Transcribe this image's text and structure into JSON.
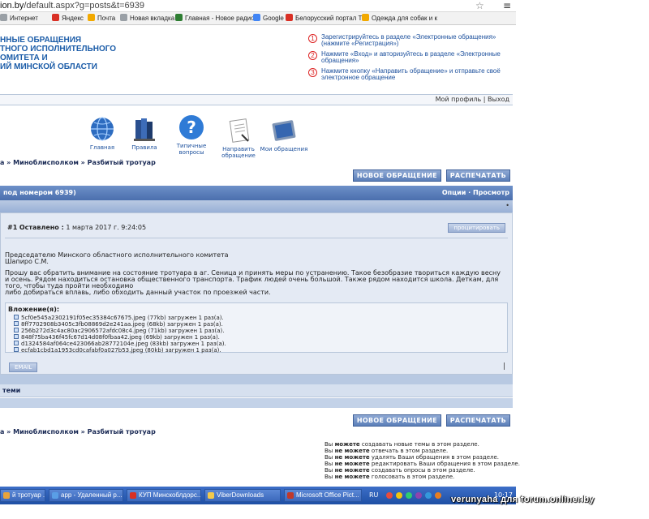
{
  "browser": {
    "url_host": "ion.by",
    "url_path": "/default.aspx?g=posts&t=6939",
    "star_icon": "star-icon",
    "menu_icon": "menu-icon"
  },
  "bookmarks": [
    {
      "label": "Интернет",
      "color": "#9aa0a6"
    },
    {
      "label": "Яндекс",
      "color": "#d93025"
    },
    {
      "label": "Почта",
      "color": "#f2a900"
    },
    {
      "label": "Новая вкладка",
      "color": "#9aa0a6"
    },
    {
      "label": "Главная - Новое радио",
      "color": "#2e7d32"
    },
    {
      "label": "Google",
      "color": "#4285f4"
    },
    {
      "label": "Белорусский портал Ti",
      "color": "#d93025"
    },
    {
      "label": "Одежда для собак и к",
      "color": "#f2a900"
    }
  ],
  "header": {
    "title_lines": [
      "ННЫЕ ОБРАЩЕНИЯ",
      "ТНОГО ИСПОЛНИТЕЛЬНОГО",
      "ОМИТЕТА И",
      "ИЙ МИНСКОЙ ОБЛАСТИ"
    ],
    "steps": [
      {
        "num": "1",
        "text": "Зарегистрируйтесь в разделе «Электронные обращения» (нажмите «Регистрация»)"
      },
      {
        "num": "2",
        "text": "Нажмите «Вход» и авторизуйтесь в разделе «Электронные обращения»"
      },
      {
        "num": "3",
        "text": "Нажмите кнопку «Направить обращение» и отправьте своё электронное обращение"
      }
    ]
  },
  "profilebar": {
    "profile": "Мой профиль",
    "sep": "|",
    "logout": "Выход"
  },
  "nav": [
    {
      "label": "Главная",
      "icon": "globe-icon"
    },
    {
      "label": "Правила",
      "icon": "books-icon"
    },
    {
      "label": "Типичные вопросы",
      "icon": "question-icon"
    },
    {
      "label": "Направить обращение",
      "icon": "document-icon"
    },
    {
      "label": "Мои обращения",
      "icon": "folder-icon"
    }
  ],
  "breadcrumb": "а » Миноблисполком » Разбитый тротуар",
  "buttons": {
    "new": "НОВОЕ ОБРАЩЕНИЕ",
    "print": "РАСПЕЧАТАТЬ"
  },
  "grid": {
    "title": "под номером 6939)",
    "options": "Опции",
    "view": "Просмотр",
    "sep": "·",
    "dot": "•"
  },
  "post": {
    "num": "#1",
    "posted_label": "Оставлено :",
    "date": "1 марта 2017 г. 9:24:05",
    "quote_btn": "процитировать",
    "addressee": "Председателю Минского областного исполнительного комитета",
    "addressee_name": "Шапиро С.М.",
    "text_1": "Прошу вас обратить внимание на состояние тротуара в аг. Сеница и принять меры по устранению. Такое безобразие твориться каждую весну и осень. Рядом находиться остановка общественного транспорта. Трафик людей очень большой. Также рядом находится школа. Деткам, для того, чтобы туда пройти необходимо",
    "text_2": "либо добираться вплавь, либо обходить данный участок по проезжей части.",
    "attach_title": "Вложение(я):",
    "attachments": [
      "5cf0e545a2302191f05ec35384c67675.jpeg (77kb) загружен 1 раз(а).",
      "8ff7702908b3405c3fb08869d2e241aa.jpeg (68kb) загружен 1 раз(а).",
      "256b272d3c4ac80ac2906572afdc08c4.jpeg (71kb) загружен 1 раз(а).",
      "848f75ba436f45fc67d14d08f0fbaa42.jpeg (69kb) загружен 1 раз(а).",
      "d1324584af064ce423066ab28772104e.jpeg (83kb) загружен 1 раз(а).",
      "ecfab1cbd1a1953cd0cafabf0a027b53.jpeg (80kb) загружен 1 раз(а)."
    ],
    "email_btn": "EMAIL",
    "pipe": "|"
  },
  "footer_row": "теми",
  "breadcrumb2": "а » Миноблисполком » Разбитый тротуар",
  "permissions": [
    {
      "pre": "Вы",
      "bold": "можете",
      "post": "создавать новые темы в этом разделе."
    },
    {
      "pre": "Вы",
      "bold": "не можете",
      "post": "отвечать в этом разделе."
    },
    {
      "pre": "Вы",
      "bold": "не можете",
      "post": "удалять Ваши обращения в этом разделе."
    },
    {
      "pre": "Вы",
      "bold": "не можете",
      "post": "редактировать Ваши обращения в этом разделе."
    },
    {
      "pre": "Вы",
      "bold": "не можете",
      "post": "создавать опросы в этом разделе."
    },
    {
      "pre": "Вы",
      "bold": "не можете",
      "post": "голосовать в этом разделе."
    }
  ],
  "taskbar": {
    "tasks": [
      {
        "label": "й тротуар ...",
        "color": "#e8a33a"
      },
      {
        "label": "app - Удаленный р...",
        "color": "#5a9ee6"
      },
      {
        "label": "КУП Минскоблдорс...",
        "color": "#d93025"
      },
      {
        "label": "ViberDownloads",
        "color": "#f2c94c"
      },
      {
        "label": "Microsoft Office Pict...",
        "color": "#c0392b"
      }
    ],
    "lang": "RU",
    "clock": "10:17"
  },
  "watermark": "verunyaha для forum.onliner.by"
}
